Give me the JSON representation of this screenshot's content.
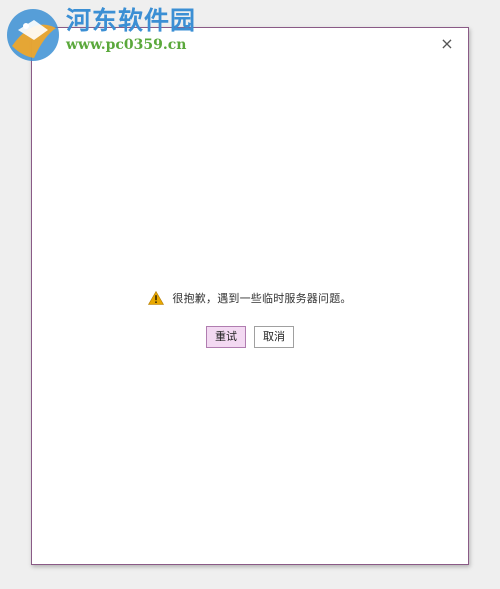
{
  "watermark": {
    "title": "河东软件园",
    "url": "www.pc0359.cn"
  },
  "dialog": {
    "close_icon": "×",
    "message": "很抱歉，遇到一些临时服务器问题。",
    "retry_label": "重试",
    "cancel_label": "取消"
  },
  "colors": {
    "dialog_border": "#8a5a86",
    "primary_button_bg": "#f3d9f2",
    "warning": "#e8a800"
  },
  "icons": {
    "warning": "warning-icon",
    "close": "close-icon",
    "logo": "logo-icon"
  }
}
